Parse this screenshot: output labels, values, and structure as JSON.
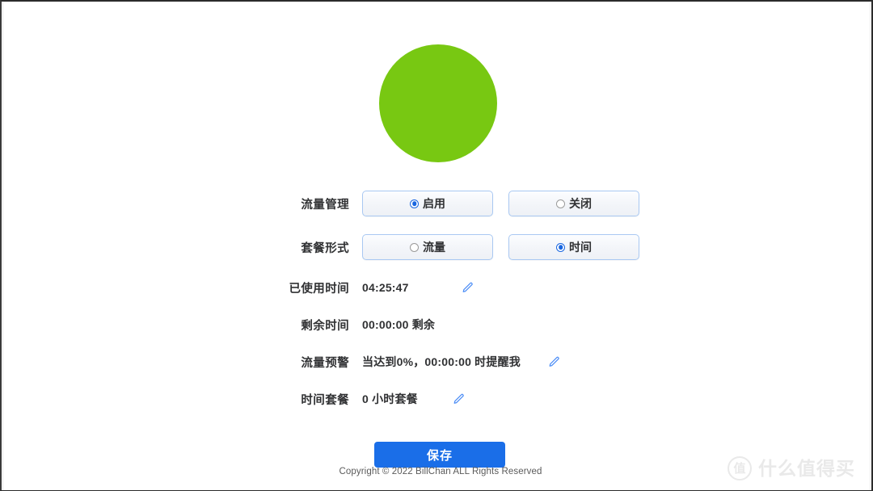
{
  "gauge": {
    "name": "usage-gauge",
    "color": "#78c812",
    "percent": 100
  },
  "form": {
    "rows": [
      {
        "label": "流量管理",
        "type": "radio",
        "options": [
          {
            "label": "启用",
            "selected": true
          },
          {
            "label": "关闭",
            "selected": false
          }
        ]
      },
      {
        "label": "套餐形式",
        "type": "radio",
        "options": [
          {
            "label": "流量",
            "selected": false
          },
          {
            "label": "时间",
            "selected": true
          }
        ]
      },
      {
        "label": "已使用时间",
        "type": "value",
        "value": "04:25:47",
        "editable": true,
        "edit_icon": "pencil-icon"
      },
      {
        "label": "剩余时间",
        "type": "value",
        "value": "00:00:00 剩余",
        "editable": false
      },
      {
        "label": "流量预警",
        "type": "value",
        "value": "当达到0%，00:00:00 时提醒我",
        "editable": true,
        "edit_icon": "pencil-icon"
      },
      {
        "label": "时间套餐",
        "type": "value",
        "value": "0 小时套餐",
        "editable": true,
        "edit_icon": "pencil-icon"
      }
    ]
  },
  "actions": {
    "save_label": "保存",
    "save_color": "#1a6ee8"
  },
  "footer": {
    "text": "Copyright © 2022 BillChan ALL Rights Reserved"
  },
  "watermark": {
    "badge": "值",
    "text": "什么值得买"
  }
}
